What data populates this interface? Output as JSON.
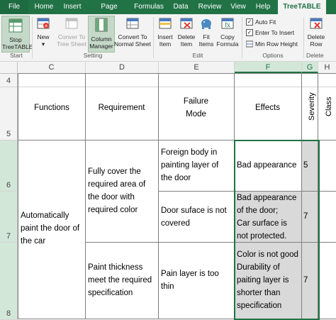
{
  "tabs": [
    "File",
    "Home",
    "Insert",
    "Page Layout",
    "Formulas",
    "Data",
    "Review",
    "View",
    "Help",
    "TreeTABLE Pro"
  ],
  "ribbon": {
    "start": {
      "stop_label_1": "Stop",
      "stop_label_2": "TreeTABLE",
      "group": "Start"
    },
    "setting": {
      "new_label": "New",
      "new_arrow": "▾",
      "convert_tree_1": "Conver To",
      "convert_tree_2": "Tree Sheet",
      "column_manager_1": "Column",
      "column_manager_2": "Manager",
      "convert_normal_1": "Convert To",
      "convert_normal_2": "Normal Sheet",
      "group": "Setting"
    },
    "edit": {
      "insert_1": "Insert",
      "insert_2": "Item",
      "delete_1": "Delete",
      "delete_2": "Item",
      "fit_1": "Fit",
      "fit_2": "Items",
      "copy_1": "Copy",
      "copy_2": "Formula",
      "group": "Edit"
    },
    "options": {
      "auto_fit": "Auto Fit",
      "enter_to_insert": "Enter To Insert",
      "min_row_height": "Min Row Height",
      "auto_fit_checked": true,
      "enter_checked": true,
      "group": "Options"
    },
    "delete": {
      "label_1": "Delete",
      "label_2": "Row",
      "group": "Delete"
    }
  },
  "columns": [
    "C",
    "D",
    "E",
    "F",
    "G",
    "H"
  ],
  "rows": [
    "4",
    "5",
    "6",
    "7",
    "8"
  ],
  "headers": {
    "functions": "Functions",
    "requirement": "Requirement",
    "failure_1": "Failure",
    "failure_2": "Mode",
    "effects": "Effects",
    "severity": "Severity",
    "class": "Class"
  },
  "cells": {
    "function": [
      "Automatically",
      "paint the door of",
      "the car"
    ],
    "req1": [
      "Fully cover the",
      "required area of",
      "the door with",
      "required color"
    ],
    "req2": [
      "Paint thickness",
      "meet the required",
      "specification"
    ],
    "fail1": [
      "Foreign body in",
      "painting layer of",
      "the door"
    ],
    "fail2": [
      "Door suface is not",
      "covered"
    ],
    "fail3": [
      "Pain layer is too",
      "thin"
    ],
    "eff1": [
      "Bad appearance"
    ],
    "eff2": [
      "Bad appearance",
      "of the door;",
      "Car surface is",
      "not protected."
    ],
    "eff3": [
      "Color is not good",
      "Durability of",
      "paiting layer is",
      "shorter than",
      "specification"
    ],
    "sev1": "5",
    "sev2": "7",
    "sev3": "7"
  }
}
